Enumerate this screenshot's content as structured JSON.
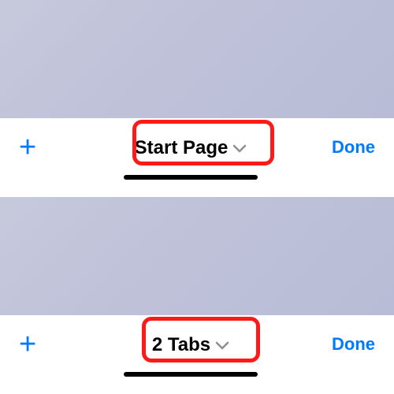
{
  "panels": [
    {
      "add_label": "+",
      "tab_group_label": "Start Page",
      "done_label": "Done"
    },
    {
      "add_label": "+",
      "tab_group_label": "2 Tabs",
      "done_label": "Done"
    }
  ],
  "annotations": {
    "highlight": "red-callout"
  }
}
